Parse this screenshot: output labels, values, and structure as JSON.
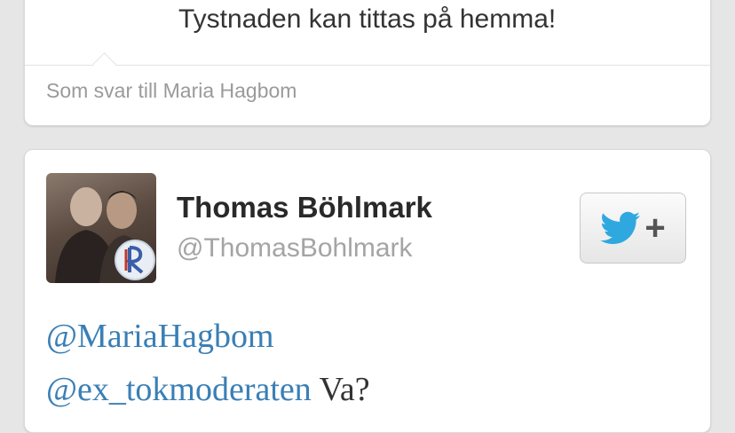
{
  "previous_tweet": {
    "text": "Tystnaden kan tittas på hemma!",
    "reply_context": "Som svar till Maria Hagbom"
  },
  "tweet": {
    "author": {
      "display_name": "Thomas Böhlmark",
      "handle": "@ThomasBohlmark",
      "avatar_icon": "profile-photo"
    },
    "follow_button": {
      "icon": "twitter-bird-icon",
      "plus": "+"
    },
    "body": {
      "mention_1": "@MariaHagbom",
      "mention_2": "@ex_tokmoderaten",
      "text_2": " Va?"
    }
  },
  "colors": {
    "mention": "#3a7fb5",
    "twitter_blue": "#2fa8e0"
  }
}
